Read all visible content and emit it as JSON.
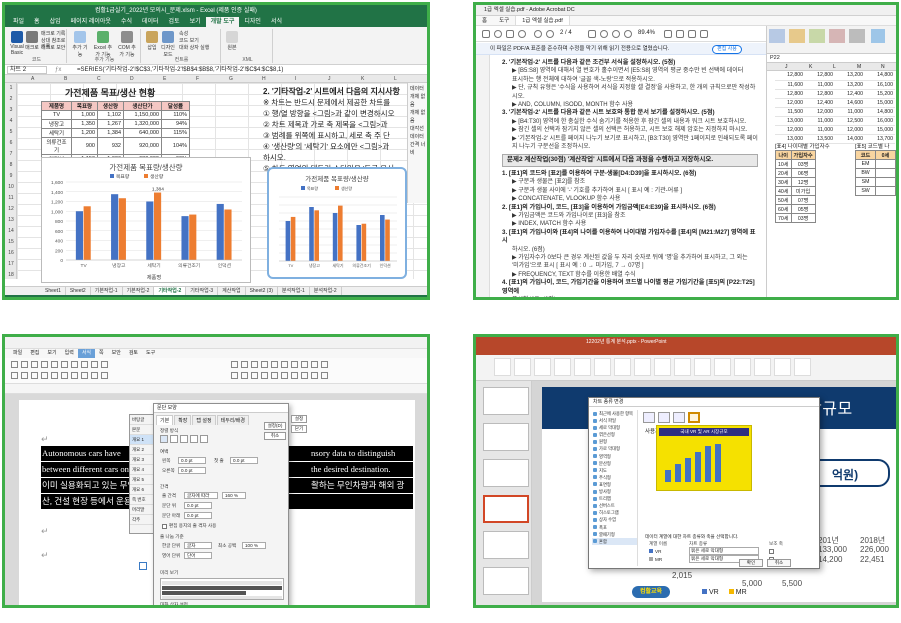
{
  "excel": {
    "window_title": "컴활1급실기_2022년 모의시_문제.xlsm - Excel (제품 인증 실패)",
    "tabs": [
      "파일",
      "홈",
      "삽입",
      "페이지 레이아웃",
      "수식",
      "데이터",
      "검토",
      "보기",
      "개발 도구",
      "디자인",
      "서식"
    ],
    "active_tab": "개발 도구",
    "ribbon": {
      "vba": "Visual Basic",
      "macro": "매크로",
      "record": "매크로 기록",
      "relative": "상대 참조로 기록",
      "security": "매크로 보안",
      "code_group": "코드",
      "addins": "추가 기능",
      "excel_addins": "Excel 추가 기능",
      "com_addins": "COM 추가 기능",
      "addins_group": "추가 기능",
      "insert": "삽입",
      "design_mode": "디자인 모드",
      "properties": "속성",
      "view_code": "코드 보기",
      "dialog": "대화 상자 실행",
      "controls_group": "컨트롤",
      "source": "원본",
      "xml_group": "XML"
    },
    "name_box": "차트 2",
    "formula": "=SERIES('기타작업-2'!$C$3,'기타작업-2'!$B$4:$B$8,'기타작업-2'!$C$4:$C$8,1)",
    "columns": [
      "A",
      "B",
      "C",
      "D",
      "E",
      "F",
      "G",
      "H",
      "I",
      "J",
      "K",
      "L",
      "M"
    ],
    "rows": [
      "1",
      "2",
      "3",
      "4",
      "5",
      "6",
      "7",
      "8",
      "9",
      "10",
      "11",
      "12",
      "13",
      "14",
      "15",
      "16",
      "17",
      "18"
    ],
    "sheet_title": "가전제품 목표/생산 현황",
    "table_headers": [
      "제품명",
      "목표량",
      "생산량",
      "생산단가",
      "달성률"
    ],
    "table_rows": [
      [
        "TV",
        "1,000",
        "1,102",
        "1,150,000",
        "110%"
      ],
      [
        "냉장고",
        "1,350",
        "1,267",
        "1,320,000",
        "94%"
      ],
      [
        "세탁기",
        "1,200",
        "1,384",
        "640,000",
        "115%"
      ],
      [
        "의류건조기",
        "900",
        "932",
        "920,000",
        "104%"
      ],
      [
        "인덕션",
        "1,150",
        "1,036",
        "680,000",
        "90%"
      ]
    ],
    "instruction_title": "2. '기타작업-2' 시트에서 다음의 지시사항",
    "instruction_lines": [
      "※ 차트는 반드시 문제에서 제공한 차트를",
      "① 행/열 방향을 <그림>과 같이 변경하시오",
      "② 차트 제목과 가로 축 제목을 <그림>과",
      "③ 범례를 위쪽에 표시하고, 세로 축 주 단",
      "④ '생산량'의 '세탁기' 요소에만 <그림>과",
      "하시오.",
      "⑤ 차트 영역의 테두리 스타일을 '둥근 모서"
    ],
    "side_pane": [
      "데이터",
      "개체 없음",
      "개체 없음",
      "대각선",
      "데이터",
      "간격 너비"
    ],
    "chart_main_legend": [
      "목표량",
      "생산량"
    ],
    "chart_main_label": "1,384",
    "chart_small_title": "가전제품 목표량/생산량",
    "chart_small_legend": [
      "목표량",
      "생산량"
    ],
    "sheets": [
      "Sheet1",
      "Sheet2",
      "기본작업-1",
      "기본작업-2",
      "기타작업-2",
      "기타작업-3",
      "계산작업",
      "Sheet2 (3)",
      "분석작업-1",
      "분석작업-2"
    ],
    "active_sheet": "기타작업-2",
    "chart_data": {
      "type": "bar",
      "title": "가전제품 목표량/생산량",
      "xlabel": "제품명",
      "ylabel": "",
      "categories": [
        "TV",
        "냉장고",
        "세탁기",
        "의류건조기",
        "인덕션"
      ],
      "series": [
        {
          "name": "목표량",
          "values": [
            1000,
            1350,
            1200,
            900,
            1150
          ]
        },
        {
          "name": "생산량",
          "values": [
            1102,
            1267,
            1384,
            932,
            1036
          ]
        }
      ],
      "ylim": [
        0,
        1600
      ],
      "yticks": [
        "0",
        "200",
        "400",
        "600",
        "800",
        "1,000",
        "1,200",
        "1,400",
        "1,600"
      ],
      "legend": "top",
      "colors": [
        "#4472c4",
        "#ed7d31"
      ]
    }
  },
  "pdf": {
    "window_title": "1급 엑셀 실습.pdf - Adobe Acrobat DC",
    "tabs": [
      "홈",
      "도구",
      "1급 엑셀 실습.pdf"
    ],
    "active_tab": "1급 엑셀 실습.pdf",
    "page_indicator": "2 / 4",
    "zoom": "89.4%",
    "info_bar": "이 파일은 PDF/A 표준을 준수하며 수정을 막기 위해 읽기 전용으로 열렸습니다.",
    "enable_button": "편집 사용",
    "content": [
      {
        "t": "h",
        "v": "2. '기본작업-2' 시트를 다음과 같은 조건부 서식을 설정하시오. (5점)"
      },
      {
        "t": "b",
        "v": "▶ [B5:S8] 영역에 대해서 열 번호가 홀수이면서 [E5:S8] 영역의 평균 중수만 빈 선택에 데이터"
      },
      {
        "t": "b",
        "v": "   표시하는 행 전체에 대하여 '글꼴 색-노랑'으로 적용하시오."
      },
      {
        "t": "b",
        "v": "▶ 단, 규칙 유형은 '수식을 사용하여 서식을 지정할 셀 결정'을 사용하고, 한 개의 규칙으로만 작성하시오."
      },
      {
        "t": "b",
        "v": "▶ AND, COLUMN, ISODD, MONTH 함수 사용"
      },
      {
        "t": "h",
        "v": "3. '기본작업-2' 시트를 다음과 같은 시트 보호와 통합 문서 보기를 설정하시오. (5점)"
      },
      {
        "t": "b",
        "v": "▶ [B4:T30] 영역에 한 충실한 수식 숨기기를 적용한 후 잠긴 셀의 내용과 워크 시트 보호하시오."
      },
      {
        "t": "b",
        "v": "▶ 잠긴 셀의 선택과 잠기지 않은 셀의 선택은 허용하고, 시트 보호 해제 암호는 지정하지 마시오."
      },
      {
        "t": "b",
        "v": "▶ '기본작업-2' 시트를 페이지 나누기 보기로 표시하고, [B3:T30] 영역만 1페이지로 인쇄되도록 페이"
      },
      {
        "t": "b",
        "v": "   지 나누기 구분선을 조정하시오."
      },
      {
        "t": "box",
        "v": "문제2 계산작업(30점) '계산작업' 시트에서 다음 과정을 수행하고 저장하시오."
      },
      {
        "t": "h",
        "v": "1. [표1]의 코드와 [표2]를 이용하여 구분-생물[D4:D39]을 표시하시오. (6점)"
      },
      {
        "t": "b",
        "v": "▶ 구분과 생물은 [표2]를 참조"
      },
      {
        "t": "b",
        "v": "▶ 구분과 생물 사이에 '-' 기호를 추가하여 표시 [ 표시 예 : 기관-어류 ]"
      },
      {
        "t": "b",
        "v": "▶ CONCATENATE, VLOOKUP 함수 사용"
      },
      {
        "t": "h",
        "v": "2. [표1]의 가입나이, 코드, [표3]을 이용하여 가입금액[E4:E39]을 표시하시오. (6점)"
      },
      {
        "t": "b",
        "v": "▶ 가입금액은 코드와 가입나이로 [표3]을 참조"
      },
      {
        "t": "b",
        "v": "▶ INDEX, MATCH 함수 사용"
      },
      {
        "t": "h",
        "v": "3. [표1]의 가입나이와 [표4]의 나이를 이용하여 나이대별 가입자수를 [표4]의 [M21:M27] 영역에 표시"
      },
      {
        "t": "b",
        "v": "   하시오. (6점)"
      },
      {
        "t": "b",
        "v": "▶ 가입자수가 0보다 큰 경우 계산된 값을 두 자리 숫자로 뒤에 '명'을 추가하여 표시하고, 그 외는"
      },
      {
        "t": "b",
        "v": "   '미가입'으로 표시 [ 표시 예 : 0 → 미가입, 7 → 07명 ]"
      },
      {
        "t": "b",
        "v": "▶ FREQUENCY, TEXT 함수를 이용한 배열 수식"
      },
      {
        "t": "h",
        "v": "4. [표1]의 가입나이, 코드, 가입기간을 이용하여 코드별 나이별 평균 가입기간을 [표5]의 [P22:T25] 영역에"
      },
      {
        "t": "b",
        "v": "   표시하시오. (6점)"
      },
      {
        "t": "b",
        "v": "▶ 단, 오류 발생시 공백으로 표시"
      },
      {
        "t": "b",
        "v": "▶ AVERAGE, IF, IFERROR 함수를 이용한 배열 수식"
      }
    ],
    "sheet": {
      "name_box": "P22",
      "columns": [
        "J",
        "K",
        "L",
        "M",
        "N",
        "O"
      ],
      "rows": [
        [
          "12,800",
          "12,800",
          "13,200",
          "14,800"
        ],
        [
          "11,600",
          "11,000",
          "13,200",
          "16,100"
        ],
        [
          "12,800",
          "12,800",
          "12,400",
          "15,200"
        ],
        [
          "12,000",
          "12,400",
          "14,600",
          "15,000"
        ],
        [
          "11,500",
          "12,000",
          "11,000",
          "14,800"
        ],
        [
          "13,000",
          "11,000",
          "12,500",
          "16,000"
        ],
        [
          "12,000",
          "11,000",
          "12,000",
          "15,000"
        ],
        [
          "13,000",
          "13,500",
          "14,000",
          "13,700"
        ]
      ],
      "table4_title": "[표4] 나이대별 가입자수",
      "table4_headers": [
        "나이",
        "가입자수"
      ],
      "table4_rows": [
        [
          "10세",
          "03명"
        ],
        [
          "20세",
          "06명"
        ],
        [
          "30세",
          "12명"
        ],
        [
          "40세",
          "미가입"
        ],
        [
          "50세",
          "07명"
        ],
        [
          "60세",
          "05명"
        ],
        [
          "70세",
          "03명"
        ]
      ],
      "table5_title": "[표5] 코드별 나",
      "table5_headers": [
        "코드",
        "0세"
      ],
      "table5_rows": [
        "EM",
        "BW",
        "SM",
        "SW"
      ]
    }
  },
  "word": {
    "tabs": [
      "파일",
      "편집",
      "보기",
      "입력",
      "서식",
      "쪽",
      "보안",
      "검토",
      "도구"
    ],
    "active_tab": "서식",
    "document_lines": [
      "Autonomous cars have",
      "between different cars on",
      "이미 실용화되고 있는 무인자",
      "산, 건설 현장 등에서 운용되"
    ],
    "document_lines_right": [
      "nsory data to distinguish",
      "the desired destination.",
      "촬하는 무인차량과 해외 광",
      ""
    ],
    "dialog": {
      "title": "문단 모양",
      "tabs": [
        "기본",
        "확장",
        "탭 설정",
        "테두리/배경"
      ],
      "section_align": "정렬 방식",
      "section_margin": "여백",
      "left_label": "왼쪽",
      "left_value": "0.0 pt",
      "right_label": "오른쪽",
      "right_value": "0.0 pt",
      "indent_label": "첫 줄",
      "indent_value": "0.0 pt",
      "section_spacing": "간격",
      "line_label": "줄 간격",
      "line_type": "글자에 따라",
      "line_value": "160 %",
      "above_label": "문단 위",
      "above_value": "0.0 pt",
      "below_label": "문단 아래",
      "below_value": "0.0 pt",
      "grid_check": "편집 용지의 줄 격자 사용",
      "section_line": "줄 나눔 기준",
      "korean_label": "한글 단위",
      "korean_value": "글자",
      "english_label": "영어 단위",
      "english_value": "단어",
      "min_space_label": "최소 공백",
      "min_space_value": "100 %",
      "preview": "미리 보기",
      "ok_button": "설정(D)",
      "cancel_button": "취소",
      "save_style": "대화 상자 설정"
    },
    "style_panel": {
      "title": "스타일",
      "items": [
        "바탕글",
        "본문",
        "개요 1",
        "개요 2",
        "개요 3",
        "개요 4",
        "개요 5",
        "개요 6",
        "쪽 번호",
        "머리말",
        "각주"
      ],
      "ok": "설정",
      "cancel": "닫기"
    }
  },
  "ppt": {
    "window_title": "12202년 통계 분석.pptx - PowerPoint",
    "slide_title": "III. 국내외 VR 및 AR 시장규모",
    "dialog": {
      "title": "차트 종류 변경",
      "left_list": [
        "최근에 사용한 항목",
        "서식 파일",
        "세로 막대형",
        "꺾은선형",
        "원형",
        "가로 막대형",
        "영역형",
        "분산형",
        "지도",
        "주식형",
        "표면형",
        "방사형",
        "트리맵",
        "선버스트",
        "히스토그램",
        "상자 수염",
        "폭포",
        "깔때기형",
        "혼합"
      ],
      "selected": "혼합",
      "combo_label": "사용자 지정 조합",
      "preview_title": "국내 VR 및 AR 시장규모",
      "series_prompt": "데이터 계열에 대한 차트 종류와 축을 선택합니다.",
      "col_series": "계열 이름",
      "col_type": "차트 종류",
      "col_axis": "보조 축",
      "series": [
        {
          "name": "VR",
          "type": "묶은 세로 막대형"
        },
        {
          "name": "MR",
          "type": "묶은 세로 막대형"
        }
      ],
      "ok": "확인",
      "cancel": "취소"
    },
    "slide_values": [
      "201년",
      "2018년",
      "133,000",
      "226,000",
      "14,200",
      "22,451",
      "2,015",
      "5,500",
      "5,000"
    ],
    "unit_label": "억원)",
    "legend": [
      "VR",
      "MR"
    ],
    "logo": "컴활교육"
  }
}
